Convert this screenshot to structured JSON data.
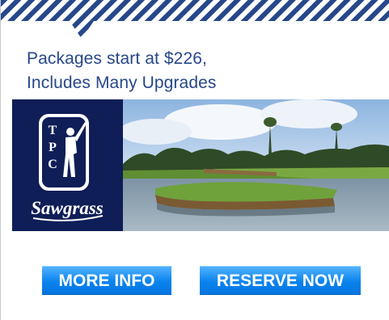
{
  "ad": {
    "headline_line1": "Packages start at $226,",
    "headline_line2": "Includes Many Upgrades",
    "logo_mark": "TPC",
    "logo_script": "Sawgrass",
    "more_info_label": "MORE INFO",
    "reserve_label": "RESERVE NOW"
  },
  "colors": {
    "stripe": "#26478a",
    "headline": "#26478a",
    "logo_panel": "#0f1e57",
    "button_blue": "#0a83ee",
    "button_text": "#ffffff"
  }
}
